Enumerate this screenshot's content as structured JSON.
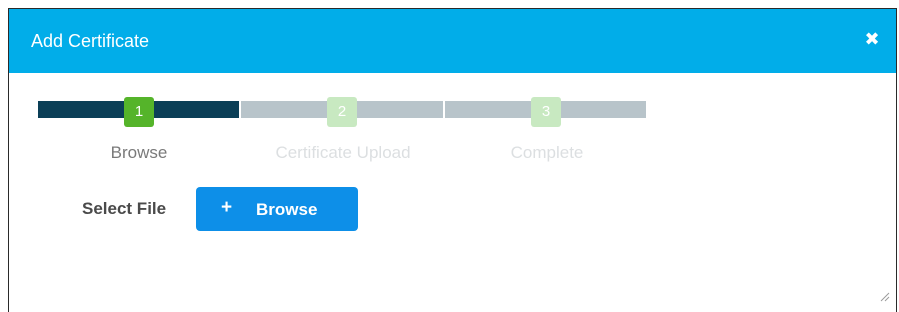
{
  "dialog": {
    "title": "Add Certificate",
    "close_icon": "close-icon",
    "close_glyph": "✖"
  },
  "stepper": {
    "steps": [
      {
        "number": "1",
        "label": "Browse",
        "state": "current"
      },
      {
        "number": "2",
        "label": "Certificate Upload",
        "state": "pending"
      },
      {
        "number": "3",
        "label": "Complete",
        "state": "pending"
      }
    ]
  },
  "form": {
    "select_file_label": "Select File",
    "browse_button": {
      "icon": "plus-icon",
      "icon_glyph": "+",
      "label": "Browse"
    }
  },
  "colors": {
    "header": "#01ade9",
    "progress_active": "#0b3f57",
    "progress_inactive": "#b8c4ca",
    "step_current": "#55b42a",
    "step_pending": "#c8e9c1",
    "button": "#0d8fe8"
  }
}
